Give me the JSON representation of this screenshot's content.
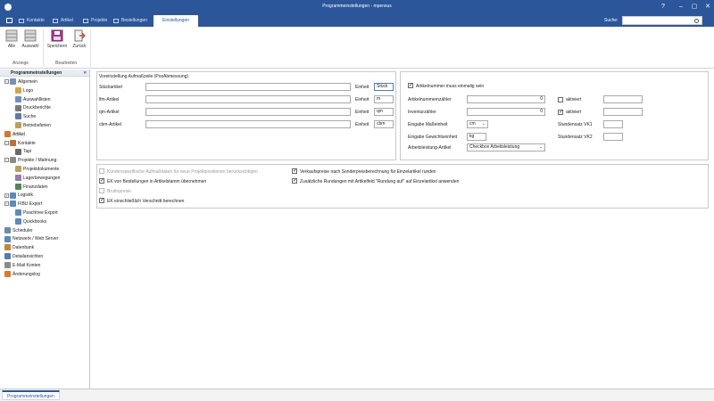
{
  "window": {
    "title": "Programmeinstellungen - mpensus"
  },
  "nav": {
    "tabs": [
      "Kontakte",
      "Artikel",
      "Projekte",
      "Bestellungen",
      "Einstellungen"
    ],
    "active_tab": "Einstellungen",
    "search_label": "Suche:",
    "search_value": ""
  },
  "ribbon": {
    "buttons": [
      {
        "label": "Alle",
        "icon": "table-grid-icon"
      },
      {
        "label": "Auswahl",
        "icon": "table-grid-icon"
      },
      {
        "label": "Speichern",
        "icon": "floppy-disk-icon"
      },
      {
        "label": "Zurück",
        "icon": "exit-door-icon"
      }
    ],
    "groups": [
      "Anzeige",
      "Bearbeiten"
    ]
  },
  "sidebar": {
    "header": "Programmeinstellungen",
    "collapse_glyph": "«",
    "items": [
      {
        "label": "Allgemein",
        "icon": "settings-icon",
        "expandable": true,
        "expanded": true
      },
      {
        "label": "Logo",
        "icon": "image-icon"
      },
      {
        "label": "Auswahllisten",
        "icon": "list-icon"
      },
      {
        "label": "Druckberichte",
        "icon": "printer-icon"
      },
      {
        "label": "Suche",
        "icon": "search-icon"
      },
      {
        "label": "Betriebsferien",
        "icon": "calendar-icon"
      },
      {
        "label": "Artikel",
        "icon": "box-icon",
        "selected": true
      },
      {
        "label": "Kontakte",
        "icon": "person-icon",
        "expandable": true,
        "expanded": true
      },
      {
        "label": "Tapi",
        "icon": "phone-icon"
      },
      {
        "label": "Projekte / Mahnung",
        "icon": "document-icon",
        "expandable": true,
        "expanded": true
      },
      {
        "label": "Projektdokumente",
        "icon": "document-icon"
      },
      {
        "label": "Lagerbewegungen",
        "icon": "warehouse-icon"
      },
      {
        "label": "Finanzdaten",
        "icon": "money-icon"
      },
      {
        "label": "Logistik",
        "icon": "truck-icon",
        "expandable": true,
        "expanded": false
      },
      {
        "label": "FIBU Export",
        "icon": "export-icon",
        "expandable": true,
        "expanded": true
      },
      {
        "label": "Peachtree Export",
        "icon": "export-icon"
      },
      {
        "label": "Quickbooks",
        "icon": "export-icon"
      },
      {
        "label": "Scheduler",
        "icon": "clock-icon"
      },
      {
        "label": "Netzwerk / Web Server",
        "icon": "network-icon"
      },
      {
        "label": "Datenbank",
        "icon": "database-icon"
      },
      {
        "label": "Detailansichten",
        "icon": "details-icon"
      },
      {
        "label": "E-Mail Konten",
        "icon": "mail-icon"
      },
      {
        "label": "Änderungslog",
        "icon": "log-icon"
      }
    ]
  },
  "settings": {
    "group_title": "Voreinstellung Aufmaßzeile (PosAbmessung)",
    "unit_label": "Einheit",
    "article_rows": [
      {
        "label": "Stückartikel",
        "value": "",
        "unit": "Stück"
      },
      {
        "label": "lfm-Artikel",
        "value": "",
        "unit": "m"
      },
      {
        "label": "qm-Artikel",
        "value": "",
        "unit": "qm"
      },
      {
        "label": "cbm-Artikel",
        "value": "",
        "unit": "cbm"
      }
    ],
    "unique_article_number": {
      "label": "Artikelnummer muss einmalig sein",
      "checked": true
    },
    "article_counter": {
      "label": "Artikelnummernzähler",
      "value": "0"
    },
    "inventory_counter": {
      "label": "Inventurzähler",
      "value": "0"
    },
    "activated_1": {
      "label": "aktiviert",
      "checked": false,
      "value": ""
    },
    "activated_2": {
      "label": "aktiviert",
      "checked": true,
      "value": ""
    },
    "measure_input": {
      "label": "Eingabe Maßeinheit",
      "value": "cm"
    },
    "weight_input": {
      "label": "Eingabe Gewichtseinheit",
      "value": "kg"
    },
    "work_article": {
      "label": "Arbeitsleistung-Artikel",
      "value": "Checkbox Arbeitsleistung"
    },
    "hourly_rate_1": {
      "label": "Stundensatz VK1",
      "value": ""
    },
    "hourly_rate_2": {
      "label": "Stundensatz VK2",
      "value": ""
    },
    "options_left": [
      {
        "label": "Kundenspezifische Aufmaßdaten für neue Projektpositionen berücksichtigen",
        "checked": false,
        "disabled": true
      },
      {
        "label": "EK von Bestellungen in Artikelstamm übernehmen",
        "checked": true,
        "disabled": false
      },
      {
        "label": "Bruttopreise",
        "checked": false,
        "disabled": true
      },
      {
        "label": "EK einschließlich Verschnitt berechnen",
        "checked": true,
        "disabled": false
      }
    ],
    "options_right": [
      {
        "label": "Verkaufspreise nach Sonderpreisberechnung für Einzelartikel runden",
        "checked": true
      },
      {
        "label": "Zusätzliche Rundungen mit Artikelfeld \"Rundung auf\" auf Einzelartikel anwenden",
        "checked": true
      }
    ]
  },
  "bottom_tabs": [
    "Programmeinstellungen"
  ],
  "colors": {
    "accent": "#2b579a",
    "selected_bg": "#f3f3f3",
    "border": "#c9c9c9"
  }
}
